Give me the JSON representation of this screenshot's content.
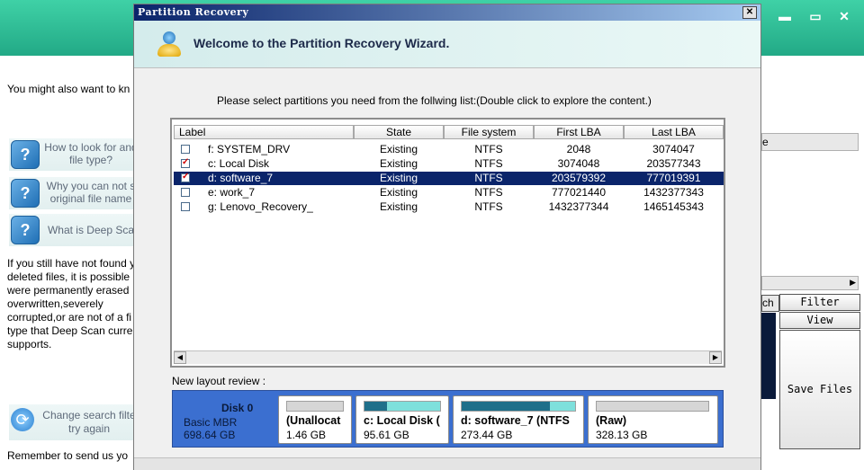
{
  "background_app": {
    "window_buttons": {
      "minimize": "▬",
      "maximize": "▭",
      "close": "✕"
    },
    "left_panel": {
      "intro": "You might also want to kn",
      "help_items": [
        {
          "line1": "How to look for and",
          "line2": "file type?"
        },
        {
          "line1": "Why you can not s",
          "line2": "original file name"
        },
        {
          "line1": "What is Deep Sca",
          "line2": ""
        }
      ],
      "description": [
        "If you still have not found y",
        "deleted files, it is possible",
        "were permanently erased",
        "overwritten,severely",
        "corrupted,or are not of a fi",
        "type that Deep Scan curre",
        "supports."
      ],
      "change_search": {
        "line1": "Change search filte",
        "line2": "try again"
      },
      "remember": "Remember to send us yo"
    },
    "right_panel": {
      "column_header": "e",
      "search_tab": "ch",
      "filter_button": "Filter",
      "view_button": "View",
      "save_button": "Save Files"
    }
  },
  "dialog": {
    "title": "Partition Recovery",
    "close": "✕",
    "heading": "Welcome to the Partition Recovery Wizard.",
    "instruction": "Please select partitions you need from the follwing list:(Double click to explore the content.)",
    "columns": {
      "label": "Label",
      "state": "State",
      "file_system": "File system",
      "first_lba": "First LBA",
      "last_lba": "Last LBA"
    },
    "rows": [
      {
        "label": "f: SYSTEM_DRV",
        "state": "Existing",
        "fs": "NTFS",
        "first": "2048",
        "last": "3074047",
        "checked": false,
        "selected": false
      },
      {
        "label": "c: Local Disk",
        "state": "Existing",
        "fs": "NTFS",
        "first": "3074048",
        "last": "203577343",
        "checked": true,
        "selected": false
      },
      {
        "label": "d: software_7",
        "state": "Existing",
        "fs": "NTFS",
        "first": "203579392",
        "last": "777019391",
        "checked": true,
        "selected": true
      },
      {
        "label": "e: work_7",
        "state": "Existing",
        "fs": "NTFS",
        "first": "777021440",
        "last": "1432377343",
        "checked": false,
        "selected": false
      },
      {
        "label": "g: Lenovo_Recovery_",
        "state": "Existing",
        "fs": "NTFS",
        "first": "1432377344",
        "last": "1465145343",
        "checked": false,
        "selected": false
      }
    ],
    "scroll": {
      "left": "◀",
      "right": "▶"
    },
    "layout_review_label": "New layout review :",
    "disk": {
      "name": "Disk 0",
      "type": "Basic MBR",
      "size": "698.64 GB"
    },
    "partitions": [
      {
        "name": "(Unallocat",
        "size": "1.46 GB",
        "used_fraction": 0.0
      },
      {
        "name": "c: Local Disk (",
        "size": "95.61 GB",
        "used_fraction": 0.3
      },
      {
        "name": "d: software_7 (NTFS",
        "size": "273.44 GB",
        "used_fraction": 0.78
      },
      {
        "name": "(Raw)",
        "size": "328.13 GB",
        "used_fraction": 0.0
      }
    ]
  }
}
